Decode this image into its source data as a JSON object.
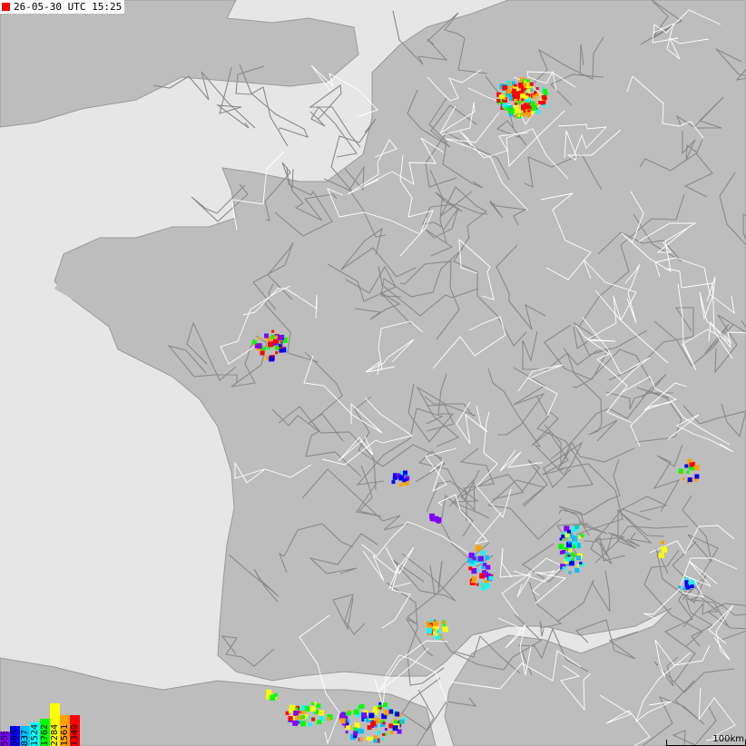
{
  "map": {
    "timestamp": "26-05-30 UTC 15:25",
    "timestamp_marker_color": "#ff0000",
    "land_color": "#bdbdbd",
    "sea_color": "#e6e6e6",
    "road_color": "#8a8a8a",
    "border_color": "#ffffff",
    "scale_label": "100km"
  },
  "legend": [
    {
      "label": "559",
      "color": "#8000ff"
    },
    {
      "label": "505",
      "color": "#0000ff"
    },
    {
      "label": "837",
      "color": "#00c0ff"
    },
    {
      "label": "1524",
      "color": "#00ffff"
    },
    {
      "label": "1762",
      "color": "#00ff00"
    },
    {
      "label": "2284",
      "color": "#ffff00"
    },
    {
      "label": "1561",
      "color": "#ffa000"
    },
    {
      "label": "1349",
      "color": "#ff0000"
    }
  ]
}
